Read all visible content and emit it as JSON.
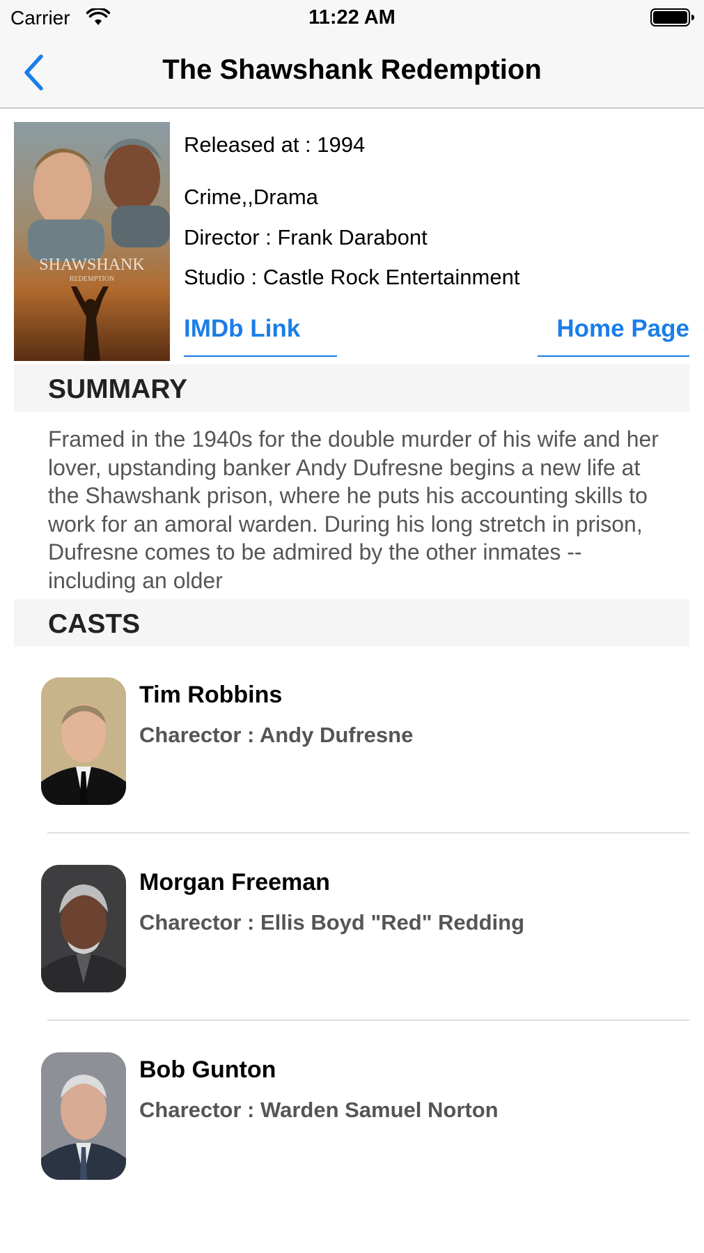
{
  "status_bar": {
    "carrier": "Carrier",
    "time": "11:22 AM"
  },
  "nav": {
    "title": "The Shawshank Redemption",
    "back_icon": "chevron-left-icon"
  },
  "movie": {
    "poster_title": "SHAWSHANK",
    "poster_subtitle": "REDEMPTION",
    "released": "Released at : 1994",
    "genres": "Crime,,Drama",
    "director": "Director : Frank Darabont",
    "studio": "Studio : Castle Rock Entertainment",
    "imdb_label": "IMDb Link",
    "home_label": "Home Page"
  },
  "summary": {
    "header": "SUMMARY",
    "text": "Framed in the 1940s for the double murder of his wife and her lover, upstanding banker Andy Dufresne begins a new life at the Shawshank prison, where he puts his accounting skills to work for an amoral warden. During his long stretch in prison, Dufresne comes to be admired by the other inmates -- including an older"
  },
  "casts": {
    "header": "CASTS",
    "items": [
      {
        "name": "Tim Robbins",
        "role": "Charector : Andy Dufresne"
      },
      {
        "name": "Morgan Freeman",
        "role": "Charector : Ellis Boyd \"Red\" Redding"
      },
      {
        "name": "Bob Gunton",
        "role": "Charector : Warden Samuel Norton"
      }
    ]
  },
  "colors": {
    "accent": "#1a7ee8",
    "section_bg": "#f5f5f5",
    "nav_bg": "#f7f7f7"
  }
}
